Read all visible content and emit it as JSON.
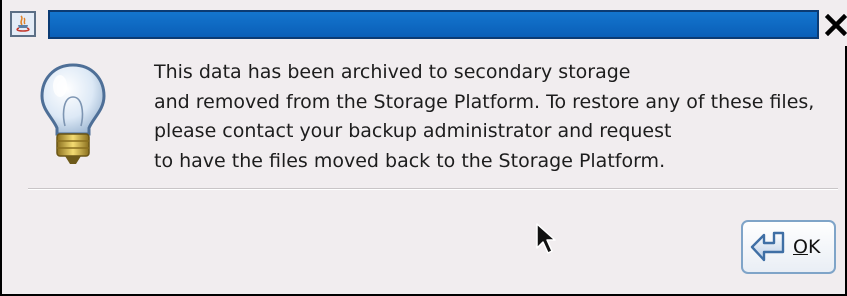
{
  "window": {
    "title": ""
  },
  "message": {
    "lines": [
      "This data has been archived to secondary storage",
      "and removed from the Storage Platform. To restore any of these files,",
      "please contact your backup administrator and request",
      "to have the files moved back to the Storage Platform."
    ]
  },
  "buttons": {
    "ok_mnemonic": "O",
    "ok_rest": "K"
  },
  "icons": {
    "window": "java-app-icon",
    "close": "close-icon",
    "message": "lightbulb-icon",
    "ok": "return-arrow-icon"
  },
  "colors": {
    "title_bar_blue": "#0a66c2",
    "dialog_background": "#f1edef",
    "text": "#1d1d1d"
  }
}
